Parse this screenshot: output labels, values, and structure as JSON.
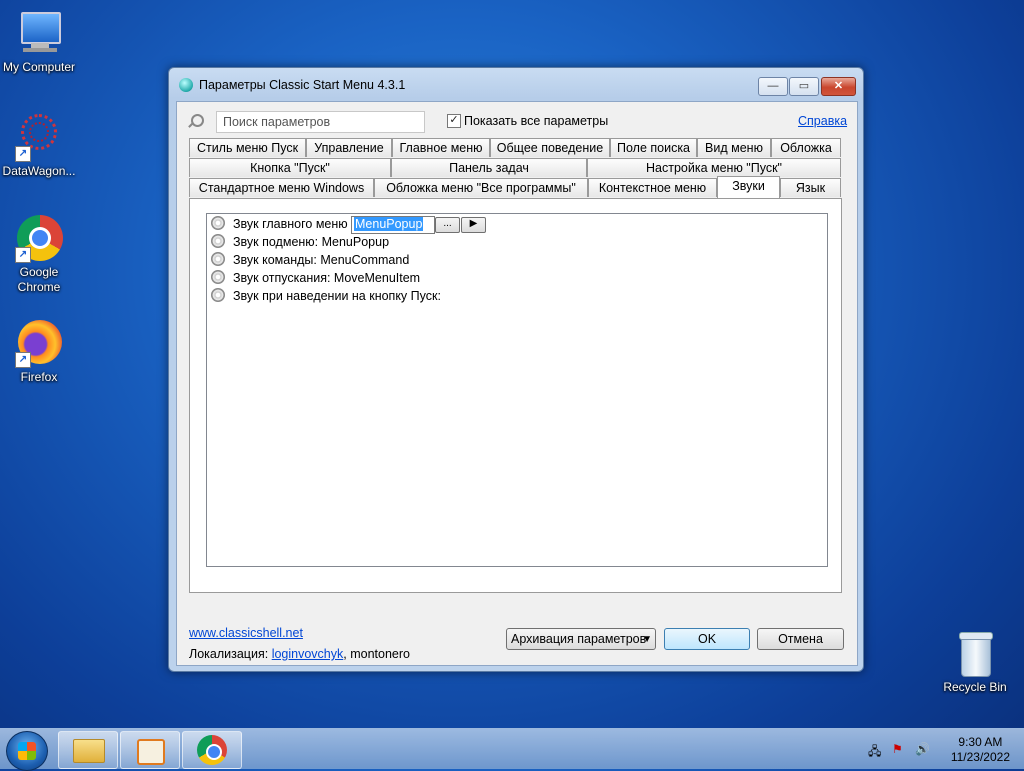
{
  "desktop": {
    "icons": [
      {
        "label": "My Computer"
      },
      {
        "label": "DataWagon..."
      },
      {
        "label": "Google Chrome"
      },
      {
        "label": "Firefox"
      },
      {
        "label": "Recycle Bin"
      }
    ]
  },
  "window": {
    "title": "Параметры Classic Start Menu 4.3.1",
    "controls": {
      "minimize": "—",
      "maximize": "▭",
      "close": "✕"
    },
    "search": {
      "placeholder": "Поиск параметров"
    },
    "show_all": {
      "label": "Показать все параметры",
      "checked": true,
      "mark": "✓"
    },
    "help_link": "Справка",
    "tabs_row1": [
      "Стиль меню Пуск",
      "Управление",
      "Главное меню",
      "Общее поведение",
      "Поле поиска",
      "Вид меню",
      "Обложка"
    ],
    "tabs_row2": [
      "Кнопка \"Пуск\"",
      "Панель задач",
      "Настройка меню \"Пуск\""
    ],
    "tabs_row3": [
      "Стандартное меню Windows",
      "Обложка меню \"Все программы\"",
      "Контекстное меню",
      "Звуки",
      "Язык"
    ],
    "active_tab": "Звуки",
    "sounds": {
      "items": [
        {
          "label": "Звук главного меню"
        },
        {
          "label": "Звук подменю: MenuPopup"
        },
        {
          "label": "Звук команды: MenuCommand"
        },
        {
          "label": "Звук отпускания: MoveMenuItem"
        },
        {
          "label": "Звук при наведении на кнопку Пуск:"
        }
      ],
      "edit_value": "MenuPopup",
      "browse_label": "...",
      "play_label": "▶"
    },
    "footer": {
      "site_link": "www.classicshell.net",
      "localization_prefix": "Локализация:",
      "localization_link": "loginvovchyk",
      "localization_suffix": ", montonero",
      "backup_button": "Архивация параметров",
      "backup_arrow": "▼",
      "ok_button": "OK",
      "cancel_button": "Отмена"
    }
  },
  "taskbar": {
    "time": "9:30 AM",
    "date": "11/23/2022"
  },
  "colors": {
    "desktop": "#1a63c4",
    "link": "#0046d5",
    "selection": "#3399ff"
  }
}
